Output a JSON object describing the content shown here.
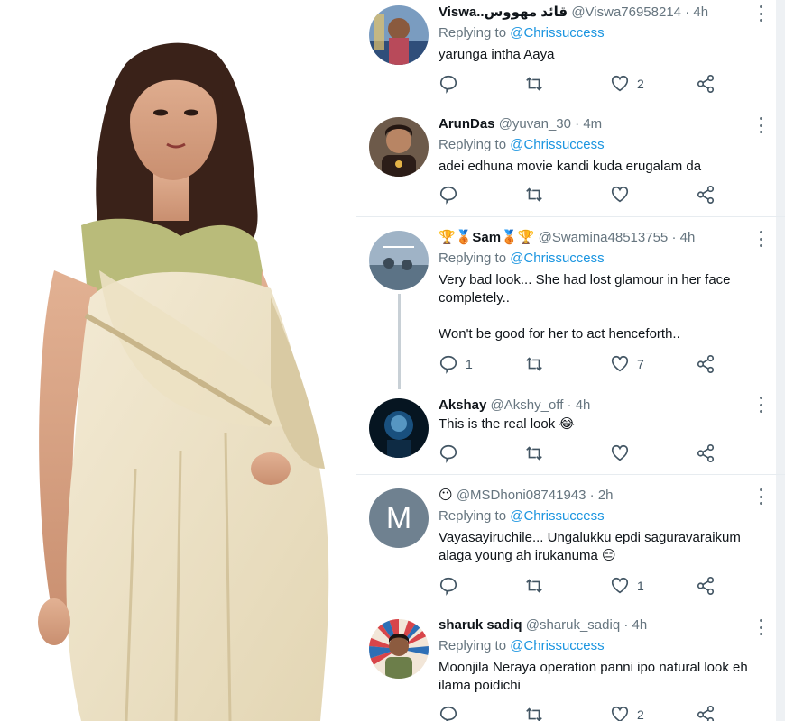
{
  "colors": {
    "link": "#1b95e0",
    "muted": "#66757f",
    "separator": "#e7ecf0",
    "thread_line": "#c8d0d6",
    "avatar_letter_bg": "#6f8190"
  },
  "photo": {
    "icon": "woman-in-saree-photo"
  },
  "tweets": [
    {
      "name": "Viswa..قائد مهووس",
      "handle": "@Viswa76958214",
      "dot": "·",
      "time": "4h",
      "reply_prefix": "Replying to",
      "reply_to": "@Chrissuccess",
      "text": "yarunga intha Aaya",
      "reply_count": "",
      "retweet_count": "",
      "like_count": "2"
    },
    {
      "name": "ArunDas",
      "handle": "@yuvan_30",
      "dot": "·",
      "time": "4m",
      "reply_prefix": "Replying to",
      "reply_to": "@Chrissuccess",
      "text": "adei edhuna movie kandi kuda erugalam da",
      "reply_count": "",
      "retweet_count": "",
      "like_count": ""
    },
    {
      "name": "Sam",
      "handle": "@Swamina48513755",
      "dot": "·",
      "time": "4h",
      "reply_prefix": "Replying to",
      "reply_to": "@Chrissuccess",
      "text": "Very bad look... She had lost glamour in her face completely..\n\nWon't be good for her to act henceforth..",
      "reply_count": "1",
      "retweet_count": "",
      "like_count": "7"
    },
    {
      "name": "Akshay",
      "handle": "@Akshy_off",
      "dot": "·",
      "time": "4h",
      "text": "This is the real look",
      "reply_count": "",
      "retweet_count": "",
      "like_count": ""
    },
    {
      "name": "",
      "handle": "@MSDhoni08741943",
      "dot": "·",
      "time": "2h",
      "avatar_letter": "M",
      "reply_prefix": "Replying to",
      "reply_to": "@Chrissuccess",
      "text": "Vayasayiruchile... Ungalukku epdi saguravaraikum alaga young ah irukanuma",
      "reply_count": "",
      "retweet_count": "",
      "like_count": "1"
    },
    {
      "name": "sharuk sadiq",
      "handle": "@sharuk_sadiq",
      "dot": "·",
      "time": "4h",
      "reply_prefix": "Replying to",
      "reply_to": "@Chrissuccess",
      "text": "Moonjila Neraya operation panni ipo natural look eh ilama poidichi",
      "reply_count": "",
      "retweet_count": "",
      "like_count": "2"
    }
  ],
  "icons": {
    "reply": "reply-icon",
    "retweet": "retweet-icon",
    "like": "heart-icon",
    "share": "share-icon",
    "more": "more-options-icon"
  }
}
